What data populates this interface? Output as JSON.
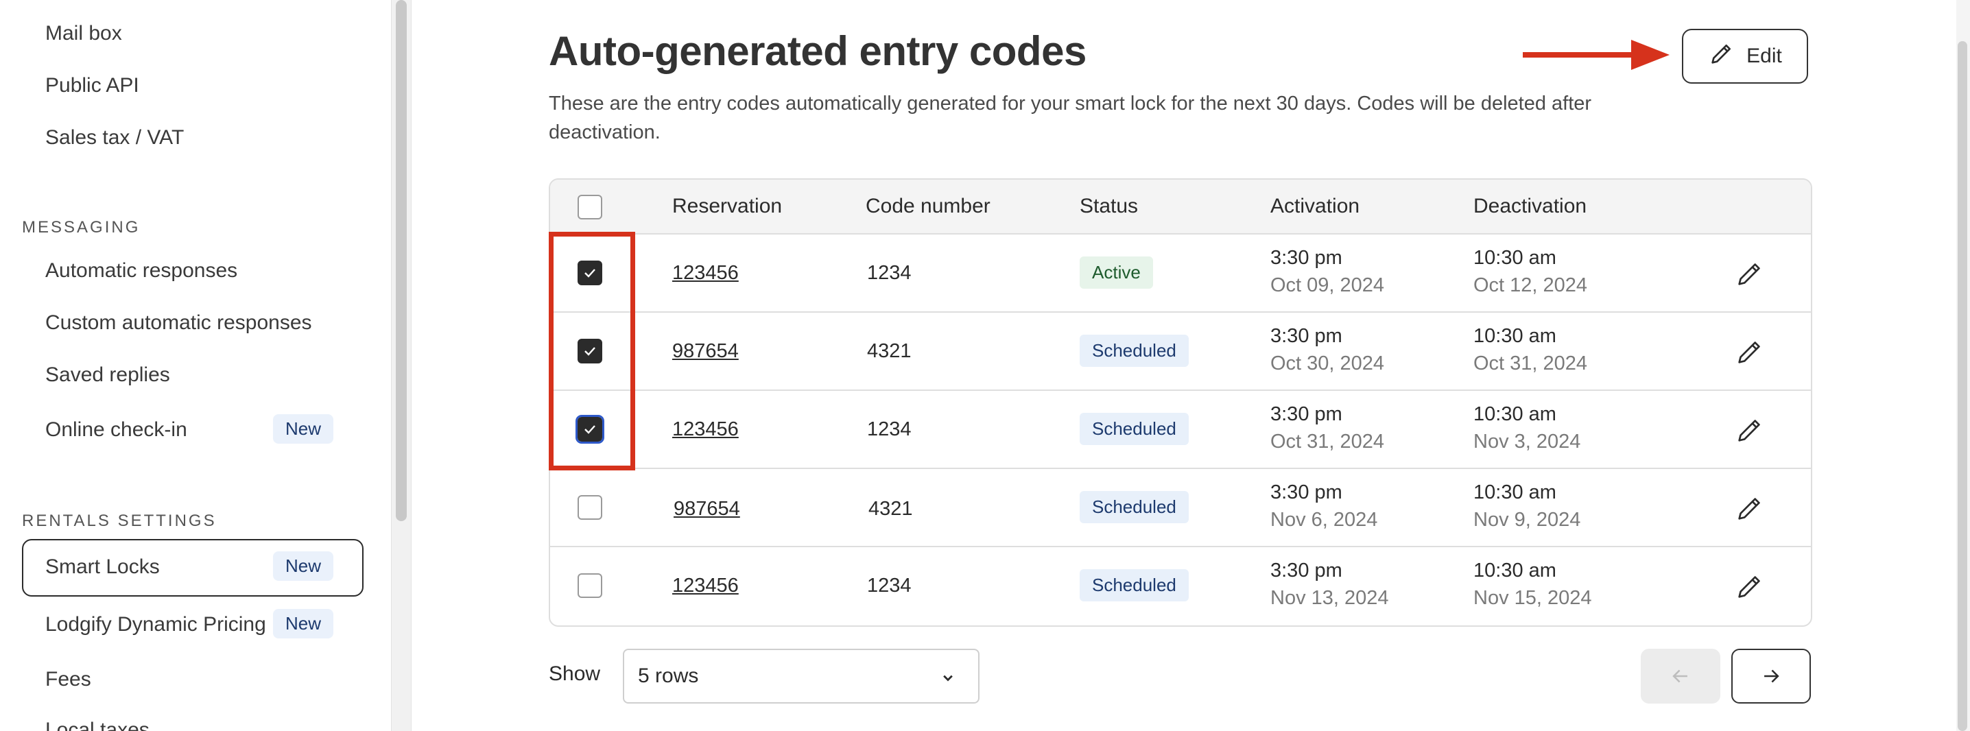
{
  "sidebar": {
    "items_top": [
      {
        "label": "Mail box"
      },
      {
        "label": "Public API"
      },
      {
        "label": "Sales tax / VAT"
      }
    ],
    "messaging_title": "MESSAGING",
    "messaging_items": [
      {
        "label": "Automatic responses"
      },
      {
        "label": "Custom automatic responses"
      },
      {
        "label": "Saved replies"
      },
      {
        "label": "Online check-in",
        "badge": "New"
      }
    ],
    "rentals_title": "RENTALS SETTINGS",
    "rentals_items": [
      {
        "label": "Smart Locks",
        "badge": "New",
        "active": true
      },
      {
        "label": "Lodgify Dynamic Pricing",
        "badge": "New"
      },
      {
        "label": "Fees"
      },
      {
        "label": "Local taxes"
      }
    ]
  },
  "main": {
    "title": "Auto-generated entry codes",
    "description": "These are the entry codes automatically generated for your smart lock for the next 30 days. Codes will be deleted after deactivation.",
    "edit_label": "Edit"
  },
  "table": {
    "headers": {
      "reservation": "Reservation",
      "code": "Code number",
      "status": "Status",
      "activation": "Activation",
      "deactivation": "Deactivation"
    },
    "rows": [
      {
        "checked": true,
        "reservation": "123456",
        "code": "1234",
        "status": "Active",
        "act_time": "3:30 pm",
        "act_date": "Oct 09, 2024",
        "deact_time": "10:30 am",
        "deact_date": "Oct 12, 2024"
      },
      {
        "checked": true,
        "reservation": "987654",
        "code": "4321",
        "status": "Scheduled",
        "act_time": "3:30 pm",
        "act_date": "Oct 30, 2024",
        "deact_time": "10:30 am",
        "deact_date": "Oct 31, 2024"
      },
      {
        "checked": true,
        "reservation": "123456",
        "code": "1234",
        "status": "Scheduled",
        "act_time": "3:30 pm",
        "act_date": "Oct 31, 2024",
        "deact_time": "10:30 am",
        "deact_date": "Nov 3, 2024"
      },
      {
        "checked": false,
        "reservation": "987654",
        "code": "4321",
        "status": "Scheduled",
        "act_time": "3:30 pm",
        "act_date": "Nov 6, 2024",
        "deact_time": "10:30 am",
        "deact_date": "Nov 9, 2024"
      },
      {
        "checked": false,
        "reservation": "123456",
        "code": "1234",
        "status": "Scheduled",
        "act_time": "3:30 pm",
        "act_date": "Nov 13, 2024",
        "deact_time": "10:30 am",
        "deact_date": "Nov 15, 2024"
      }
    ]
  },
  "pagination": {
    "show_label": "Show",
    "rows_value": "5 rows"
  },
  "colors": {
    "annotation_red": "#d6321c",
    "active_bg": "#e7f4ea",
    "scheduled_bg": "#e8f0fa"
  },
  "icons": [
    "pencil-icon",
    "arrow-left-icon",
    "arrow-right-icon",
    "chevron-down-icon",
    "check-icon"
  ]
}
